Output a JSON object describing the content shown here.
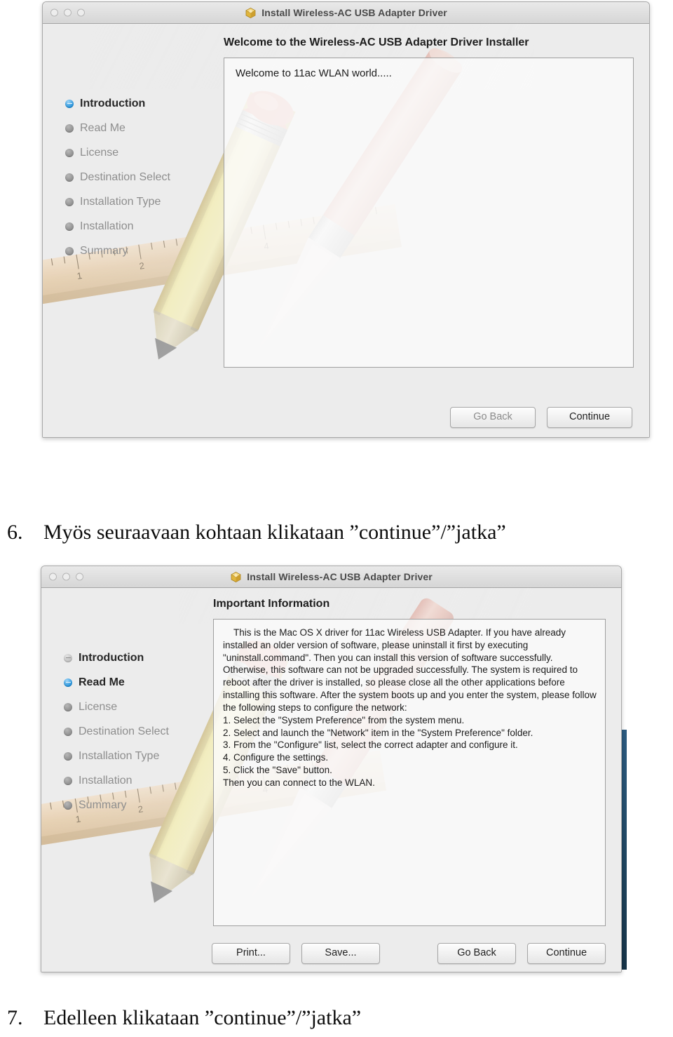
{
  "document": {
    "page_background": "#ffffff",
    "accent_blue": "#1f8ed8",
    "desktop_strip_color": "#234f70"
  },
  "screenshot_1": {
    "window": {
      "title": "Install Wireless-AC USB Adapter Driver",
      "icon": "installer-package-icon",
      "traffic_lights": [
        "close",
        "minimize",
        "zoom"
      ]
    },
    "sidebar": {
      "items": [
        {
          "label": "Introduction",
          "state": "current"
        },
        {
          "label": "Read Me",
          "state": "pending"
        },
        {
          "label": "License",
          "state": "pending"
        },
        {
          "label": "Destination Select",
          "state": "pending"
        },
        {
          "label": "Installation Type",
          "state": "pending"
        },
        {
          "label": "Installation",
          "state": "pending"
        },
        {
          "label": "Summary",
          "state": "pending"
        }
      ]
    },
    "pane": {
      "heading": "Welcome to the Wireless-AC USB Adapter Driver Installer",
      "body": "Welcome to 11ac WLAN world....."
    },
    "buttons": [
      {
        "label": "Go Back",
        "style": "muted"
      },
      {
        "label": "Continue",
        "style": "default"
      }
    ]
  },
  "caption_6": {
    "number": "6.",
    "text": "Myös seuraavaan kohtaan klikataan ”continue”/”jatka”"
  },
  "screenshot_2": {
    "window": {
      "title": "Install Wireless-AC USB Adapter Driver",
      "icon": "installer-package-icon",
      "traffic_lights": [
        "close",
        "minimize",
        "zoom"
      ]
    },
    "sidebar": {
      "items": [
        {
          "label": "Introduction",
          "state": "visited"
        },
        {
          "label": "Read Me",
          "state": "current"
        },
        {
          "label": "License",
          "state": "pending"
        },
        {
          "label": "Destination Select",
          "state": "pending"
        },
        {
          "label": "Installation Type",
          "state": "pending"
        },
        {
          "label": "Installation",
          "state": "pending"
        },
        {
          "label": "Summary",
          "state": "pending"
        }
      ]
    },
    "pane": {
      "heading": "Important Information",
      "body": "    This is the Mac OS X driver for 11ac Wireless USB Adapter. If you have already installed an older version of software, please uninstall it first by executing \"uninstall.command\". Then you can install this version of software successfully. Otherwise, this software can not be upgraded successfully. The system is required to reboot after the driver is installed, so please close all the other applications before installing this software. After the system boots up and you enter the system, please follow the following steps to configure the network:\n1. Select the \"System Preference\" from the system menu.\n2. Select and launch the \"Network\" item in the \"System Preference\" folder.\n3. From the \"Configure\" list, select the correct adapter and configure it.\n4. Configure the settings.\n5. Click the \"Save\" button.\nThen you can connect to the WLAN."
    },
    "buttons_left": [
      {
        "label": "Print...",
        "style": "default"
      },
      {
        "label": "Save...",
        "style": "default"
      }
    ],
    "buttons_right": [
      {
        "label": "Go Back",
        "style": "default"
      },
      {
        "label": "Continue",
        "style": "default"
      }
    ]
  },
  "caption_7": {
    "number": "7.",
    "text": "Edelleen klikataan ”continue”/”jatka”"
  }
}
